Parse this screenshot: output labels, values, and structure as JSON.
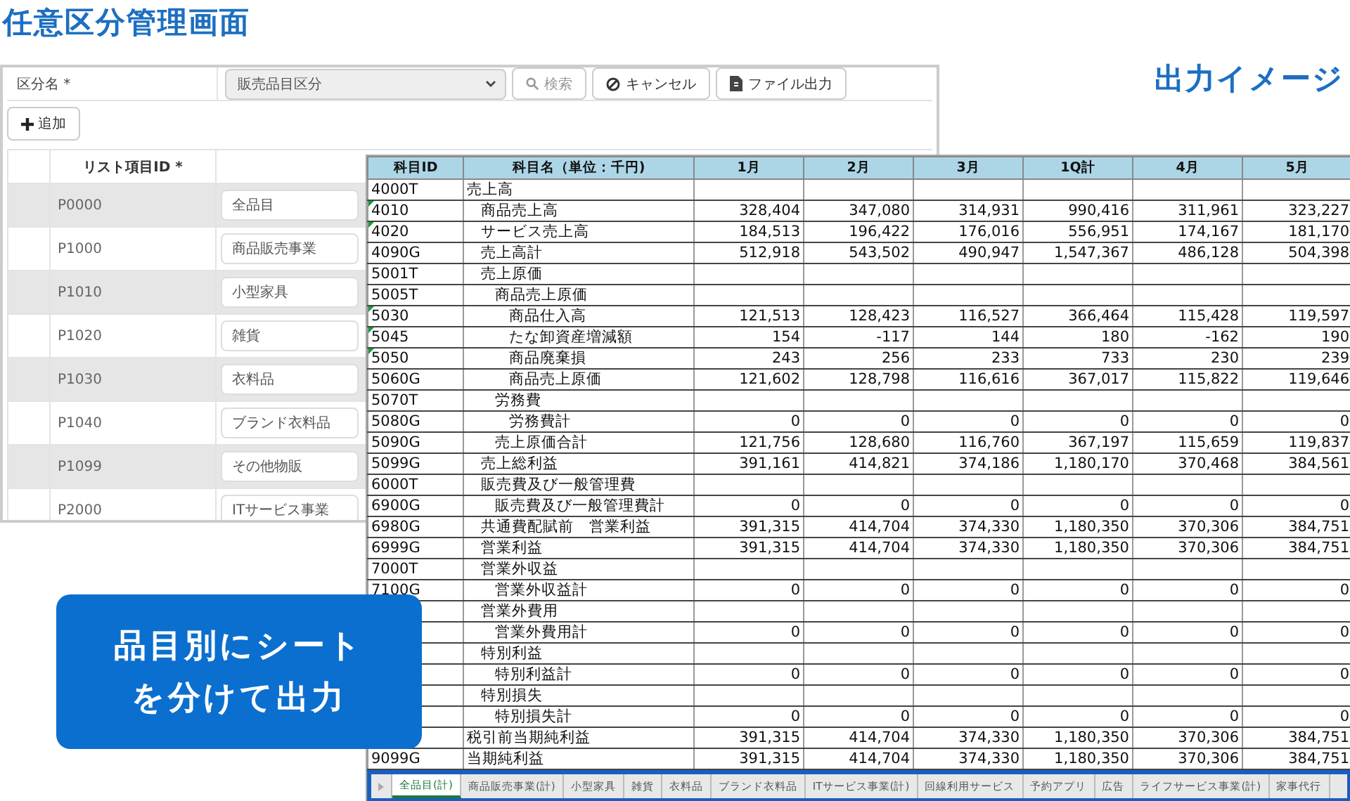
{
  "page_title": "任意区分管理画面",
  "output_heading": "出力イメージ",
  "admin": {
    "category_label": "区分名 *",
    "category_value": "販売品目区分",
    "buttons": [
      {
        "kind": "search",
        "label": "検索",
        "disabled": true
      },
      {
        "kind": "cancel",
        "label": "キャンセル",
        "disabled": false
      },
      {
        "kind": "export",
        "label": "ファイル出力",
        "disabled": false
      }
    ],
    "add_button": "追加",
    "columns": [
      "リスト項目ID *"
    ],
    "rows": [
      {
        "id": "P0000",
        "name": "全品目",
        "shaded": true
      },
      {
        "id": "P1000",
        "name": "商品販売事業",
        "shaded": false
      },
      {
        "id": "P1010",
        "name": "小型家具",
        "shaded": true
      },
      {
        "id": "P1020",
        "name": "雑貨",
        "shaded": false
      },
      {
        "id": "P1030",
        "name": "衣料品",
        "shaded": true
      },
      {
        "id": "P1040",
        "name": "ブランド衣料品",
        "shaded": false
      },
      {
        "id": "P1099",
        "name": "その他物販",
        "shaded": true
      },
      {
        "id": "P2000",
        "name": "ITサービス事業",
        "shaded": false
      }
    ]
  },
  "sheet": {
    "columns": [
      "科目ID",
      "科目名（単位：千円)",
      "1月",
      "2月",
      "3月",
      "1Q計",
      "4月",
      "5月"
    ],
    "rows": [
      {
        "id": "4000T",
        "name": "売上高",
        "marked": false,
        "children": [
          {
            "id": "4010",
            "name": "商品売上高",
            "marked": true,
            "values": [
              "328,404",
              "347,080",
              "314,931",
              "990,416",
              "311,961",
              "323,227"
            ]
          },
          {
            "id": "4020",
            "name": "サービス売上高",
            "marked": true,
            "values": [
              "184,513",
              "196,422",
              "176,016",
              "556,951",
              "174,167",
              "181,170"
            ]
          },
          {
            "id": "4090G",
            "name": "売上高計",
            "marked": false,
            "values": [
              "512,918",
              "543,502",
              "490,947",
              "1,547,367",
              "486,128",
              "504,398"
            ]
          },
          {
            "id": "5001T",
            "name": "売上原価",
            "marked": false,
            "children": [
              {
                "id": "5005T",
                "name": "商品売上原価",
                "marked": false,
                "children": [
                  {
                    "id": "5030",
                    "name": "商品仕入高",
                    "marked": true,
                    "values": [
                      "121,513",
                      "128,423",
                      "116,527",
                      "366,464",
                      "115,428",
                      "119,597"
                    ]
                  },
                  {
                    "id": "5045",
                    "name": "たな卸資産増減額",
                    "marked": true,
                    "values": [
                      "154",
                      "-117",
                      "144",
                      "180",
                      "-162",
                      "190"
                    ]
                  },
                  {
                    "id": "5050",
                    "name": "商品廃棄損",
                    "marked": true,
                    "values": [
                      "243",
                      "256",
                      "233",
                      "733",
                      "230",
                      "239"
                    ]
                  },
                  {
                    "id": "5060G",
                    "name": "商品売上原価",
                    "marked": false,
                    "values": [
                      "121,602",
                      "128,798",
                      "116,616",
                      "367,017",
                      "115,822",
                      "119,646"
                    ]
                  }
                ]
              },
              {
                "id": "5070T",
                "name": "労務費",
                "marked": false,
                "children": [
                  {
                    "id": "5080G",
                    "name": "労務費計",
                    "marked": false,
                    "values": [
                      "0",
                      "0",
                      "0",
                      "0",
                      "0",
                      "0"
                    ]
                  }
                ]
              },
              {
                "id": "5090G",
                "name": "売上原価合計",
                "marked": false,
                "values": [
                  "121,756",
                  "128,680",
                  "116,760",
                  "367,197",
                  "115,659",
                  "119,837"
                ]
              }
            ]
          },
          {
            "id": "5099G",
            "name": "売上総利益",
            "marked": false,
            "values": [
              "391,161",
              "414,821",
              "374,186",
              "1,180,170",
              "370,468",
              "384,561"
            ]
          },
          {
            "id": "6000T",
            "name": "販売費及び一般管理費",
            "marked": false,
            "children": [
              {
                "id": "6900G",
                "name": "販売費及び一般管理費計",
                "marked": false,
                "values": [
                  "0",
                  "0",
                  "0",
                  "0",
                  "0",
                  "0"
                ]
              }
            ]
          },
          {
            "id": "6980G",
            "name": "共通費配賦前　営業利益",
            "marked": false,
            "values": [
              "391,315",
              "414,704",
              "374,330",
              "1,180,350",
              "370,306",
              "384,751"
            ]
          },
          {
            "id": "6999G",
            "name": "営業利益",
            "marked": false,
            "values": [
              "391,315",
              "414,704",
              "374,330",
              "1,180,350",
              "370,306",
              "384,751"
            ]
          },
          {
            "id": "7000T",
            "name": "営業外収益",
            "marked": false,
            "children": [
              {
                "id": "7100G",
                "name": "営業外収益計",
                "marked": false,
                "values": [
                  "0",
                  "0",
                  "0",
                  "0",
                  "0",
                  "0"
                ]
              }
            ]
          },
          {
            "name": "営業外費用",
            "children": [
              {
                "name": "営業外費用計",
                "values": [
                  "0",
                  "0",
                  "0",
                  "0",
                  "0",
                  "0"
                ]
              }
            ]
          },
          {
            "name": "特別利益",
            "children": [
              {
                "name": "特別利益計",
                "values": [
                  "0",
                  "0",
                  "0",
                  "0",
                  "0",
                  "0"
                ]
              }
            ]
          },
          {
            "name": "特別損失",
            "children": [
              {
                "name": "特別損失計",
                "values": [
                  "0",
                  "0",
                  "0",
                  "0",
                  "0",
                  "0"
                ]
              }
            ]
          }
        ]
      },
      {
        "name": "税引前当期純利益",
        "values": [
          "391,315",
          "414,704",
          "374,330",
          "1,180,350",
          "370,306",
          "384,751"
        ]
      },
      {
        "id": "9099G",
        "name": "当期純利益",
        "marked": false,
        "values": [
          "391,315",
          "414,704",
          "374,330",
          "1,180,350",
          "370,306",
          "384,751"
        ]
      }
    ],
    "tabs": [
      {
        "label": "全品目(計)",
        "selected": true
      },
      {
        "label": "商品販売事業(計)",
        "selected": false
      },
      {
        "label": "小型家具",
        "selected": false
      },
      {
        "label": "雑貨",
        "selected": false
      },
      {
        "label": "衣料品",
        "selected": false
      },
      {
        "label": "ブランド衣料品",
        "selected": false
      },
      {
        "label": "ITサービス事業(計)",
        "selected": false
      },
      {
        "label": "回線利用サービス",
        "selected": false
      },
      {
        "label": "予約アプリ",
        "selected": false
      },
      {
        "label": "広告",
        "selected": false
      },
      {
        "label": "ライフサービス事業(計)",
        "selected": false
      },
      {
        "label": "家事代行",
        "selected": false
      }
    ]
  },
  "callout": {
    "lines": [
      "品目別にシート",
      "を分けて出力"
    ]
  }
}
